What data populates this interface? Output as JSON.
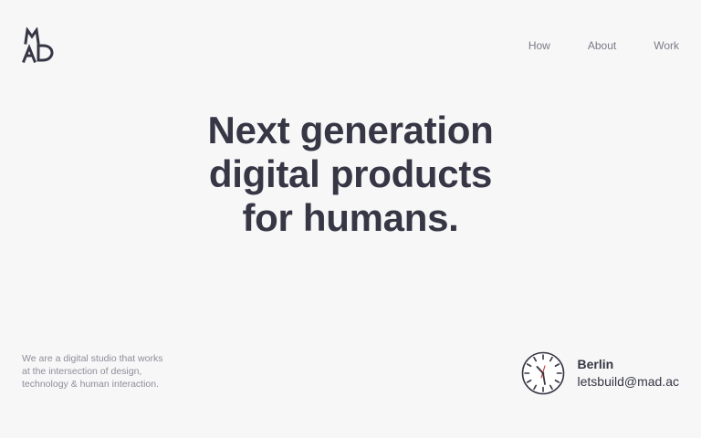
{
  "brand": {
    "logo_icon": "mad-logo-icon"
  },
  "nav": {
    "items": [
      {
        "label": "How"
      },
      {
        "label": "About"
      },
      {
        "label": "Work"
      }
    ]
  },
  "hero": {
    "lines": [
      "Next generation",
      "digital products",
      "for humans."
    ]
  },
  "about": {
    "lines": [
      "We are a digital studio that works",
      "at the intersection of design,",
      "technology & human interaction."
    ]
  },
  "contact": {
    "clock_icon": "wall-clock-icon",
    "city": "Berlin",
    "email": "letsbuild@mad.ac"
  },
  "colors": {
    "background": "#f7f7f8",
    "text": "#363645",
    "muted": "#8e8e99",
    "clock_second_hand": "#d2322d"
  }
}
